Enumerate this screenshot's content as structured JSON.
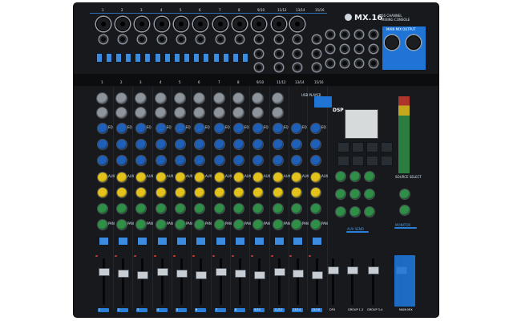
{
  "brand": {
    "model": "MX.16",
    "subtitle1": "16 CHANNEL",
    "subtitle2": "MIXING CONSOLE"
  },
  "channels_top": [
    "1",
    "2",
    "3",
    "4",
    "5",
    "6",
    "7",
    "8",
    "9/10",
    "11/12",
    "13/14",
    "15/16"
  ],
  "channels_mid": [
    "1",
    "2",
    "3",
    "4",
    "5",
    "6",
    "7",
    "8",
    "9/10",
    "11/12",
    "13/14",
    "15/16"
  ],
  "main_mix_output_label": "MAIN MIX OUTPUT",
  "usb_label": "USB PLAYER",
  "dsp_label": "DSP",
  "source_select_label": "SOURCE SELECT",
  "monitor_label": "MONITOR",
  "aux_send_label": "AUX SEND",
  "bottom_labels": [
    "1",
    "2",
    "3",
    "4",
    "5",
    "6",
    "7",
    "8",
    "9/10",
    "11/12",
    "13/14",
    "15/16",
    "DFX",
    "GROUP 1-2",
    "GROUP 3-4",
    "MAIN MIX"
  ],
  "strip_labels": {
    "eq": "EQ",
    "aux": "AUX",
    "pan": "PAN"
  },
  "colors": {
    "panel": "#17191c",
    "accent": "#2a7fd9",
    "knob_blue": "#1e5fb8",
    "knob_yellow": "#e3c21c",
    "knob_green": "#2f8f47",
    "knob_gray": "#8e949b"
  }
}
